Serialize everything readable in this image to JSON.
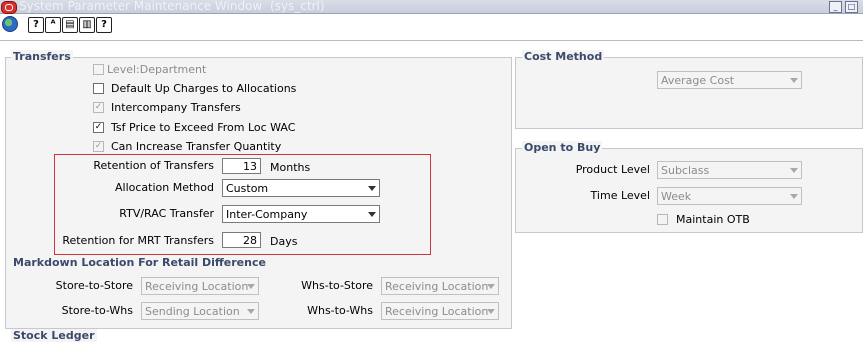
{
  "window": {
    "title": "System Parameter Maintenance Window",
    "subtitle": "(sys_ctrl)"
  },
  "toolbar": {
    "icons": [
      "globe-icon",
      "help-icon",
      "spell-check-icon",
      "copy-icon",
      "print-icon",
      "question-icon"
    ]
  },
  "transfers": {
    "title": "Transfers",
    "level_department": "Level:Department",
    "default_up_charges": "Default Up Charges to Allocations",
    "intercompany_transfers": "Intercompany Transfers",
    "tsf_price_exceed": "Tsf Price to Exceed From Loc WAC",
    "can_increase_qty": "Can Increase Transfer Quantity",
    "retention_of_transfers": {
      "label": "Retention of Transfers",
      "value": "13",
      "unit": "Months"
    },
    "allocation_method": {
      "label": "Allocation Method",
      "value": "Custom"
    },
    "rtv_rac_transfer": {
      "label": "RTV/RAC Transfer",
      "value": "Inter-Company"
    },
    "retention_mrt": {
      "label": "Retention for MRT Transfers",
      "value": "28",
      "unit": "Days"
    }
  },
  "markdown": {
    "title": "Markdown Location For Retail Difference",
    "store_to_store": {
      "label": "Store-to-Store",
      "value": "Receiving Location"
    },
    "store_to_whs": {
      "label": "Store-to-Whs",
      "value": "Sending Location"
    },
    "whs_to_store": {
      "label": "Whs-to-Store",
      "value": "Receiving Location"
    },
    "whs_to_whs": {
      "label": "Whs-to-Whs",
      "value": "Receiving Location"
    }
  },
  "stock_ledger": {
    "title": "Stock Ledger"
  },
  "cost_method": {
    "title": "Cost Method",
    "value": "Average Cost"
  },
  "open_to_buy": {
    "title": "Open to Buy",
    "product_level": {
      "label": "Product Level",
      "value": "Subclass"
    },
    "time_level": {
      "label": "Time Level",
      "value": "Week"
    },
    "maintain_otb": "Maintain OTB"
  },
  "colors": {
    "highlight_box": "#d0343a",
    "title_text": "#3a4a6a"
  }
}
